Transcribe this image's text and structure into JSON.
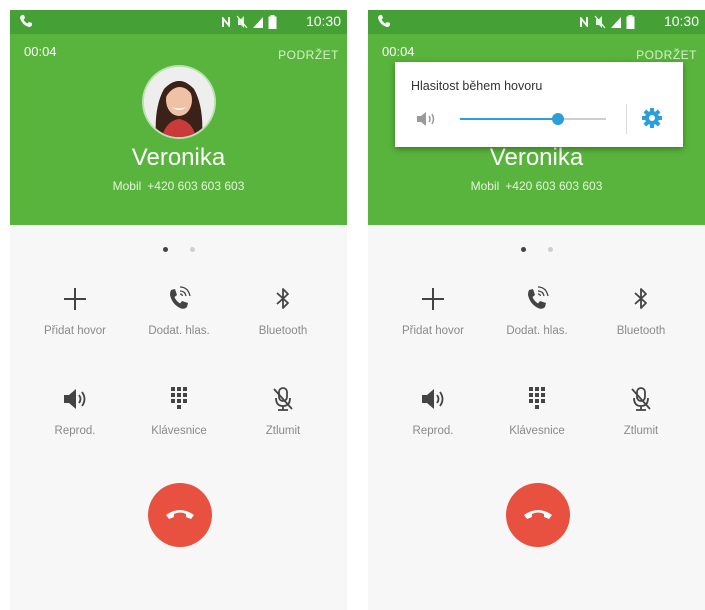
{
  "status_bar": {
    "time": "10:30"
  },
  "call": {
    "timer": "00:04",
    "hold_label": "PODRŽET",
    "caller_name": "Veronika",
    "number_type": "Mobil",
    "number": "+420 603 603 603"
  },
  "actions": {
    "add_call": "Přidat hovor",
    "extra_volume": "Dodat. hlas.",
    "bluetooth": "Bluetooth",
    "speaker": "Reprod.",
    "keypad": "Klávesnice",
    "mute": "Ztlumit"
  },
  "volume_popup": {
    "title": "Hlasitost během hovoru",
    "level_fraction": 0.67
  },
  "colors": {
    "status_bar": "#45a035",
    "header": "#58b43c",
    "end_call": "#e8503f",
    "slider": "#2a9fd8"
  }
}
